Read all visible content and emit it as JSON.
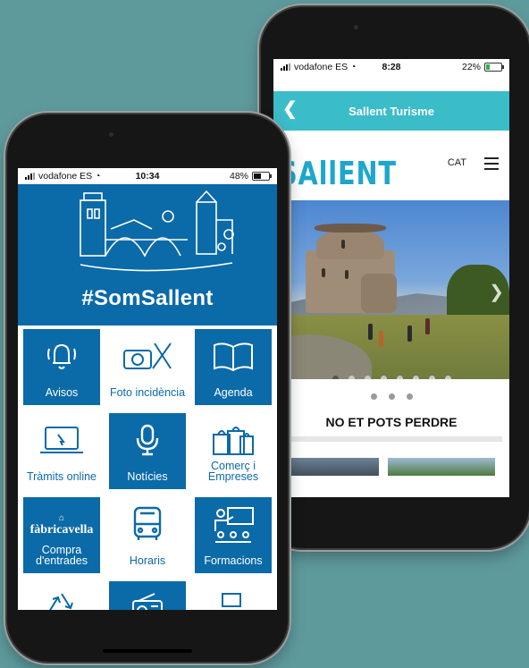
{
  "back_phone": {
    "status": {
      "carrier": "vodafone ES",
      "time": "8:28",
      "battery": "22%"
    },
    "navbar": {
      "title": "Sallent Turisme",
      "back_icon": "back-arrow-icon"
    },
    "header": {
      "logo": "SAllENT",
      "language": "CAT",
      "menu_icon": "hamburger-menu-icon"
    },
    "carousel": {
      "slide_count": 8,
      "active_index": 0
    },
    "section_title": "NO ET POTS PERDRE"
  },
  "front_phone": {
    "status": {
      "carrier": "vodafone ES",
      "time": "10:34",
      "battery": "48%"
    },
    "banner": {
      "hashtag": "#SomSallent",
      "pages": 5,
      "active_page": 0
    },
    "tiles": [
      {
        "label": "Avisos",
        "icon": "bell-icon",
        "style": "blue"
      },
      {
        "label": "Foto incidència",
        "icon": "camera-tools-icon",
        "style": "white"
      },
      {
        "label": "Agenda",
        "icon": "book-icon",
        "style": "blue"
      },
      {
        "label": "Tràmits online",
        "icon": "laptop-click-icon",
        "style": "white"
      },
      {
        "label": "Notícies",
        "icon": "microphone-icon",
        "style": "blue"
      },
      {
        "label": "Comerç i Empreses",
        "icon": "shopping-bags-icon",
        "style": "white"
      },
      {
        "label": "Compra d'entrades",
        "icon": "fabricavella-logo",
        "style": "blue",
        "logo_text": "fàbricavella"
      },
      {
        "label": "Horaris",
        "icon": "bus-icon",
        "style": "white"
      },
      {
        "label": "Formacions",
        "icon": "teacher-icon",
        "style": "blue"
      },
      {
        "label": "",
        "icon": "recycle-icon",
        "style": "white"
      },
      {
        "label": "",
        "icon": "radio-icon",
        "style": "blue"
      },
      {
        "label": "",
        "icon": "desk-icon",
        "style": "white"
      }
    ]
  }
}
